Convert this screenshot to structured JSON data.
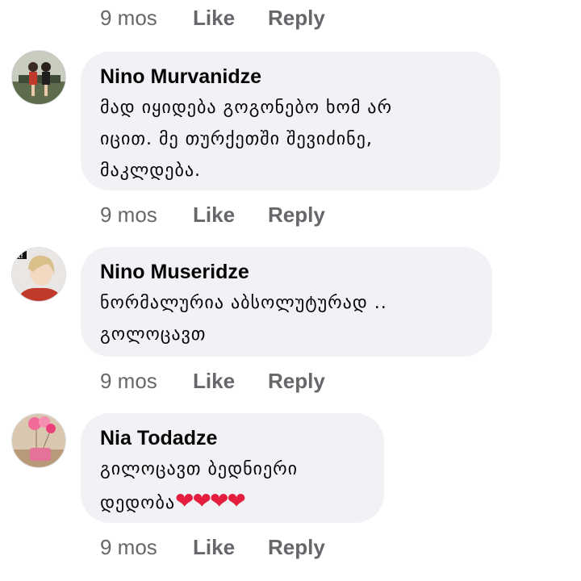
{
  "top_actions": {
    "time": "9 mos",
    "like": "Like",
    "reply": "Reply"
  },
  "comments": [
    {
      "author": "Nino Murvanidze",
      "text": "მად იყიდება გოგონებო ხომ არ\nიცით. მე თურქეთში შევიძინე,\nმაკლდება.",
      "time": "9 mos",
      "like": "Like",
      "reply": "Reply"
    },
    {
      "author": "Nino Museridze",
      "text": "ნორმალურია აბსოლუტურად ..\nგოლოცავთ",
      "time": "9 mos",
      "like": "Like",
      "reply": "Reply"
    },
    {
      "author": "Nia Todadze",
      "text": "გილოცავთ ბედნიერი\nდედობა",
      "hearts": "❤❤❤❤",
      "time": "9 mos",
      "like": "Like",
      "reply": "Reply"
    }
  ],
  "colors": {
    "bubble_bg": "#f0f2f5",
    "meta_text": "#65676b",
    "heart": "#e41e3f"
  }
}
